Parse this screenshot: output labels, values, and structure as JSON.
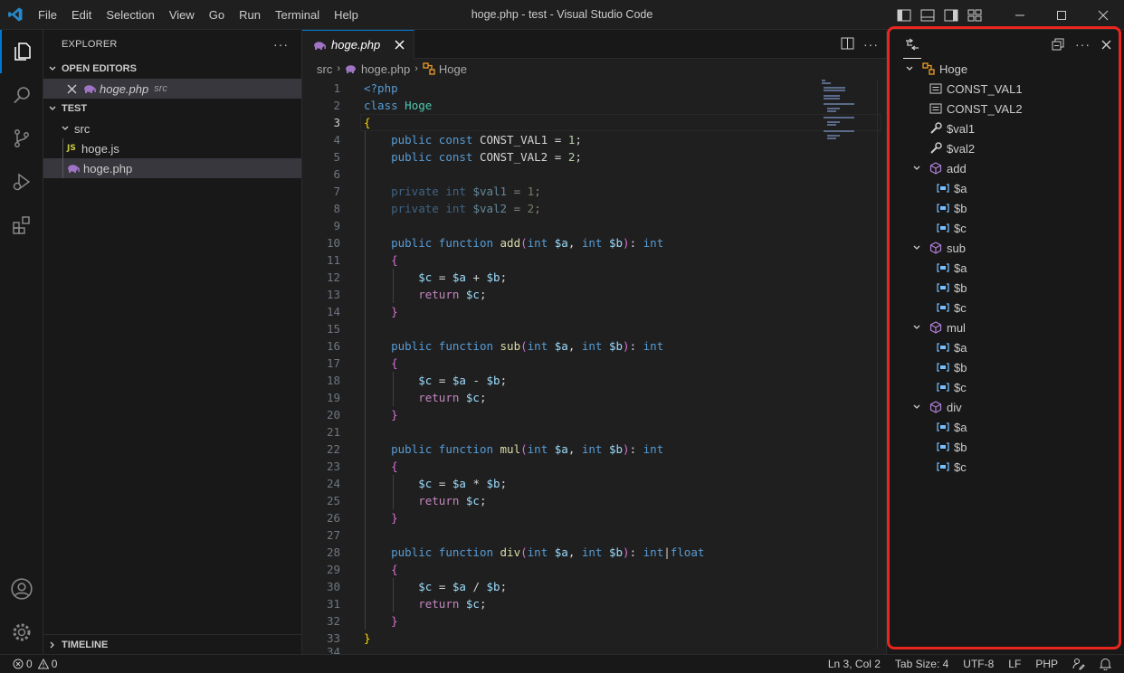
{
  "window": {
    "title": "hoge.php - test - Visual Studio Code"
  },
  "menu": [
    "File",
    "Edit",
    "Selection",
    "View",
    "Go",
    "Run",
    "Terminal",
    "Help"
  ],
  "colors": {
    "accent": "#0078d4",
    "highlight_box": "#e8261d",
    "php_icon": "#a074c4",
    "js_icon": "#cbcb41"
  },
  "explorer": {
    "title": "EXPLORER",
    "open_editors_label": "OPEN EDITORS",
    "open_editor": {
      "name": "hoge.php",
      "desc": "src",
      "icon": "php-elephant-icon"
    },
    "folder_label": "TEST",
    "src_folder": "src",
    "files": [
      {
        "name": "hoge.js",
        "icon_text": "JS"
      },
      {
        "name": "hoge.php",
        "icon": "php-elephant-icon"
      }
    ],
    "timeline_label": "TIMELINE"
  },
  "editor": {
    "tab_label": "hoge.php",
    "breadcrumb": [
      "src",
      "hoge.php",
      "Hoge"
    ],
    "line_numbers": [
      "1",
      "2",
      "3",
      "4",
      "5",
      "6",
      "7",
      "8",
      "9",
      "10",
      "11",
      "12",
      "13",
      "14",
      "15",
      "16",
      "17",
      "18",
      "19",
      "20",
      "21",
      "22",
      "23",
      "24",
      "25",
      "26",
      "27",
      "28",
      "29",
      "30",
      "31",
      "32",
      "33",
      "34"
    ],
    "current_line": 3
  },
  "outline": {
    "root": "Hoge",
    "constants": [
      "CONST_VAL1",
      "CONST_VAL2"
    ],
    "properties": [
      "$val1",
      "$val2"
    ],
    "methods": [
      {
        "name": "add",
        "vars": [
          "$a",
          "$b",
          "$c"
        ]
      },
      {
        "name": "sub",
        "vars": [
          "$a",
          "$b",
          "$c"
        ]
      },
      {
        "name": "mul",
        "vars": [
          "$a",
          "$b",
          "$c"
        ]
      },
      {
        "name": "div",
        "vars": [
          "$a",
          "$b",
          "$c"
        ]
      }
    ]
  },
  "status": {
    "errors": "0",
    "warnings": "0",
    "position": "Ln 3, Col 2",
    "tab_size": "Tab Size: 4",
    "encoding": "UTF-8",
    "eol": "LF",
    "language": "PHP"
  }
}
